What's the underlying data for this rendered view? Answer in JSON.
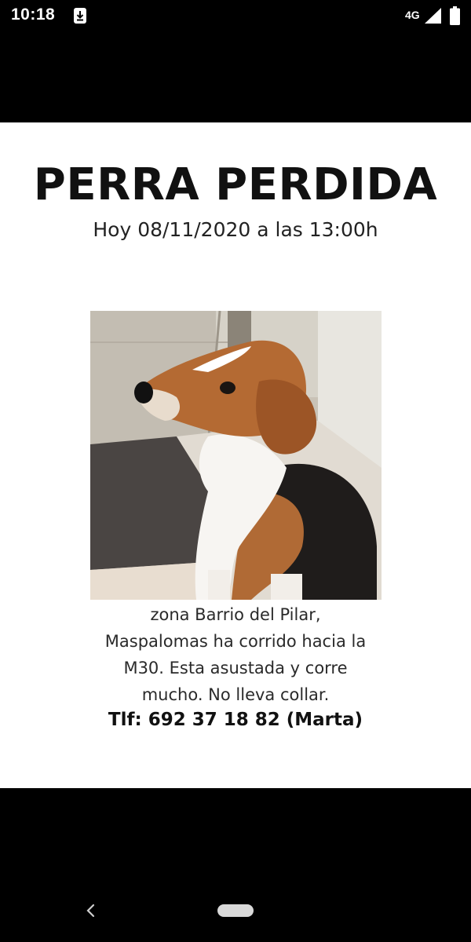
{
  "status_bar": {
    "time": "10:18",
    "network": "4G",
    "icons": [
      "download-icon",
      "signal-icon",
      "battery-icon"
    ]
  },
  "poster": {
    "title": "PERRA PERDIDA",
    "date_line": "Hoy 08/11/2020 a las 13:00h",
    "photo": "beagle-dog-photo",
    "description_lines": [
      "zona Barrio del Pilar,",
      "Maspalomas ha corrido hacia la",
      "M30. Esta asustada y corre",
      "mucho. No lleva collar."
    ],
    "phone": "Tlf: 692 37 18 82 (Marta)"
  },
  "nav_bar": {
    "icons": [
      "back-icon",
      "home-pill-icon"
    ]
  },
  "colors": {
    "background": "#000000",
    "poster_bg": "#ffffff",
    "text": "#111111"
  }
}
